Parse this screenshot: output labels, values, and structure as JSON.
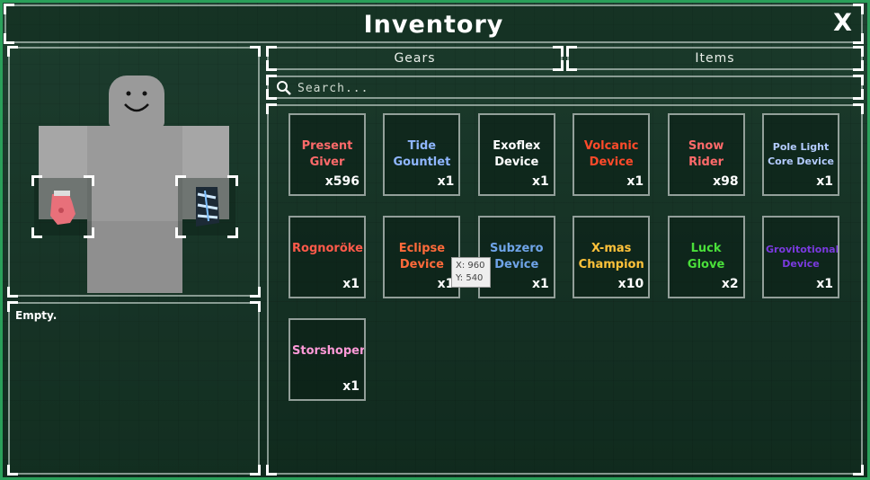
{
  "window": {
    "title": "Inventory",
    "close_label": "X"
  },
  "tabs": {
    "gears": "Gears",
    "items": "Items"
  },
  "search": {
    "placeholder": "Search..."
  },
  "description": {
    "text": "Empty."
  },
  "items": [
    {
      "name": "Present Giver",
      "count": "x596",
      "color": "#ff6a6a"
    },
    {
      "name": "Tide Gountlet",
      "count": "x1",
      "color": "#8fb6ff"
    },
    {
      "name": "Exoflex Device",
      "count": "x1",
      "color": "#ffffff"
    },
    {
      "name": "Volcanic Device",
      "count": "x1",
      "color": "#ff4a2a"
    },
    {
      "name": "Snow Rider",
      "count": "x98",
      "color": "#ff6a6a"
    },
    {
      "name": "Pole Light Core Device",
      "count": "x1",
      "color": "#b4ccff"
    },
    {
      "name": "Rognoröker",
      "count": "x1",
      "color": "#ff5a4a"
    },
    {
      "name": "Eclipse Device",
      "count": "x1",
      "color": "#ff6a3a"
    },
    {
      "name": "Subzero Device",
      "count": "x1",
      "color": "#6fa4e8"
    },
    {
      "name": "X-mas Champion",
      "count": "x10",
      "color": "#ffc23a"
    },
    {
      "name": "Luck Glove",
      "count": "x2",
      "color": "#4adf3a"
    },
    {
      "name": "Grovitotional Device",
      "count": "x1",
      "color": "#7a3adf"
    },
    {
      "name": "Storshoper",
      "count": "x1",
      "color": "#ff9ad8"
    }
  ],
  "tooltip": {
    "x": "X: 960",
    "y": "Y: 540"
  },
  "icons": {
    "search": "search-icon",
    "close": "close-icon"
  }
}
